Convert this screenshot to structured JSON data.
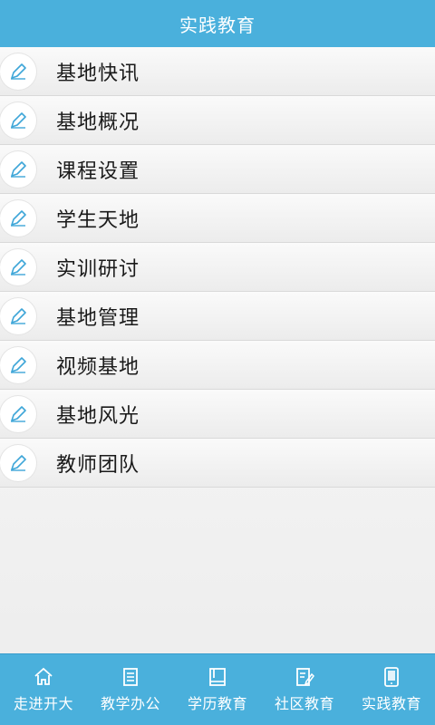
{
  "header": {
    "title": "实践教育"
  },
  "menu": {
    "items": [
      {
        "label": "基地快讯",
        "icon": "pencil-icon"
      },
      {
        "label": "基地概况",
        "icon": "pencil-icon"
      },
      {
        "label": "课程设置",
        "icon": "pencil-icon"
      },
      {
        "label": "学生天地",
        "icon": "pencil-icon"
      },
      {
        "label": "实训研讨",
        "icon": "pencil-icon"
      },
      {
        "label": "基地管理",
        "icon": "pencil-icon"
      },
      {
        "label": "视频基地",
        "icon": "pencil-icon"
      },
      {
        "label": "基地风光",
        "icon": "pencil-icon"
      },
      {
        "label": "教师团队",
        "icon": "pencil-icon"
      }
    ]
  },
  "tabbar": {
    "tabs": [
      {
        "label": "走进开大",
        "icon": "home-icon"
      },
      {
        "label": "教学办公",
        "icon": "document-icon"
      },
      {
        "label": "学历教育",
        "icon": "book-icon"
      },
      {
        "label": "社区教育",
        "icon": "edit-document-icon"
      },
      {
        "label": "实践教育",
        "icon": "tablet-icon"
      }
    ]
  },
  "colors": {
    "header_bg": "#4ab0dc",
    "tabbar_bg": "#4ab0dc",
    "icon_accent": "#3ea6d8",
    "text": "#1a1a1a"
  }
}
